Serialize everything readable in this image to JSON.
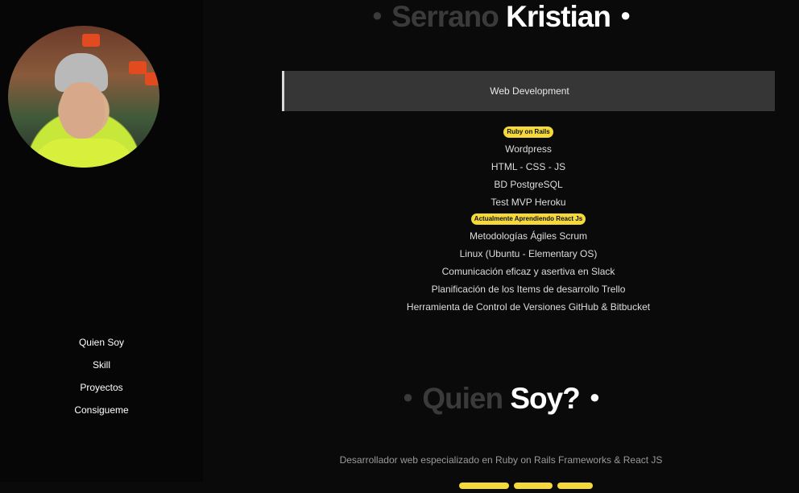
{
  "sidebar": {
    "nav": [
      "Quien Soy",
      "Skill",
      "Proyectos",
      "Consigueme"
    ]
  },
  "header": {
    "first": "Serrano",
    "second": "Kristian"
  },
  "skills": {
    "title": "Web Development",
    "items": [
      {
        "text": "Ruby on Rails",
        "badge": true
      },
      {
        "text": "Wordpress",
        "badge": false
      },
      {
        "text": "HTML - CSS - JS",
        "badge": false
      },
      {
        "text": "BD PostgreSQL",
        "badge": false
      },
      {
        "text": "Test MVP Heroku",
        "badge": false
      },
      {
        "text": "Actualmente Aprendiendo React Js",
        "badge": true
      },
      {
        "text": "Metodologías Ágiles Scrum",
        "badge": false
      },
      {
        "text": "Linux (Ubuntu - Elementary OS)",
        "badge": false
      },
      {
        "text": "Comunicación eficaz y asertiva en Slack",
        "badge": false
      },
      {
        "text": "Planificación de los Items de desarrollo Trello",
        "badge": false
      },
      {
        "text": "Herramienta de Control de Versiones GitHub & Bitbucket",
        "badge": false
      }
    ]
  },
  "about": {
    "first": "Quien",
    "second": "Soy?",
    "description": "Desarrollador web especializado en Ruby on Rails Frameworks & React JS"
  },
  "colors": {
    "accent": "#f5d93a",
    "background": "#0a0a0a",
    "muted_heading": "#3a3a3a"
  }
}
